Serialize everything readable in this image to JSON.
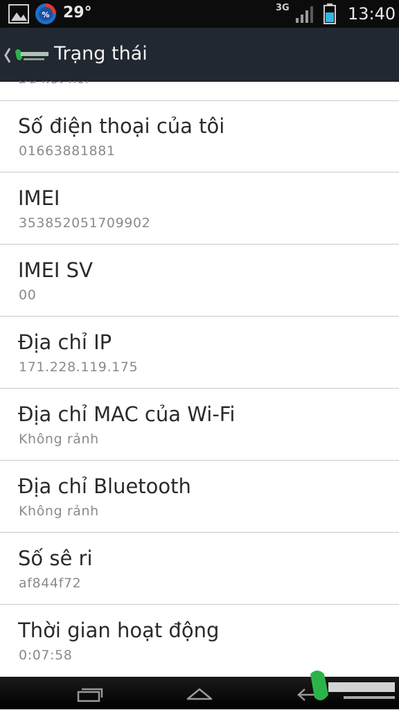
{
  "status_bar": {
    "temperature": "29°",
    "network": "3G",
    "time": "13:40",
    "icons": [
      "picture-icon",
      "clean-master-icon",
      "signal-icon",
      "battery-icon"
    ]
  },
  "action_bar": {
    "title": "Trạng thái",
    "app_icon": "back-app-logo-icon"
  },
  "list": {
    "partial_value": "Đã kết nối",
    "items": [
      {
        "title": "Số điện thoại của tôi",
        "value": "01663881881"
      },
      {
        "title": "IMEI",
        "value": "353852051709902"
      },
      {
        "title": "IMEI SV",
        "value": "00"
      },
      {
        "title": "Địa chỉ IP",
        "value": "171.228.119.175"
      },
      {
        "title": "Địa chỉ MAC của Wi-Fi",
        "value": "Không rảnh"
      },
      {
        "title": "Địa chỉ Bluetooth",
        "value": "Không rảnh"
      },
      {
        "title": "Số sê ri",
        "value": "af844f72"
      },
      {
        "title": "Thời gian hoạt động",
        "value": "0:07:58"
      }
    ]
  },
  "nav_bar": {
    "icons": [
      "recent-apps-icon",
      "home-icon",
      "back-icon"
    ]
  },
  "colors": {
    "action_bar": "#222831",
    "status_bar": "#0c0c0c",
    "divider": "#c9c9c9",
    "title_text": "#2a2a2a",
    "value_text": "#8a8a8a",
    "battery": "#33b5e5",
    "watermark_green": "#2bb34a"
  }
}
